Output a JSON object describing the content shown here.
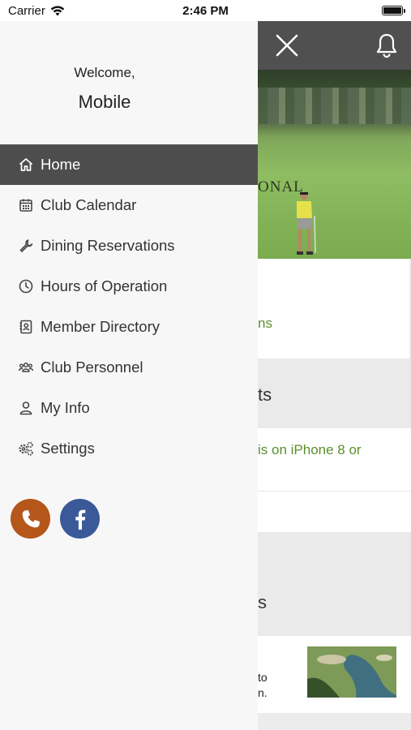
{
  "status_bar": {
    "carrier": "Carrier",
    "time": "2:46 PM"
  },
  "drawer": {
    "welcome": "Welcome,",
    "username": "Mobile",
    "items": [
      {
        "label": "Home",
        "icon": "home-icon",
        "active": true
      },
      {
        "label": "Club Calendar",
        "icon": "calendar-icon"
      },
      {
        "label": "Dining Reservations",
        "icon": "wrench-icon"
      },
      {
        "label": "Hours of Operation",
        "icon": "clock-icon"
      },
      {
        "label": "Member Directory",
        "icon": "contact-book-icon"
      },
      {
        "label": "Club Personnel",
        "icon": "people-icon"
      },
      {
        "label": "My Info",
        "icon": "user-icon"
      },
      {
        "label": "Settings",
        "icon": "gears-icon"
      }
    ],
    "social": [
      {
        "icon": "phone-icon",
        "color": "#b5561b"
      },
      {
        "icon": "facebook-icon",
        "color": "#3b5998"
      }
    ]
  },
  "background": {
    "hero_text": "ONAL",
    "card1_link": "ns",
    "section1_title": "ts",
    "card2_link": "is on iPhone 8 or",
    "section2_title": "s",
    "card4_line1": "to",
    "card4_line2": "n."
  },
  "colors": {
    "accent_green": "#5b8f2c",
    "header_gray": "#505050",
    "active_item": "#4d4d4d"
  }
}
